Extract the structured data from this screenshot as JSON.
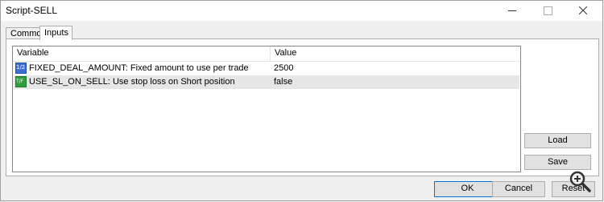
{
  "window": {
    "title": "Script-SELL"
  },
  "tabs": [
    {
      "label": "Common",
      "active": false
    },
    {
      "label": "Inputs",
      "active": true
    }
  ],
  "grid": {
    "columns": [
      "Variable",
      "Value"
    ],
    "rows": [
      {
        "icon": "numeric-input-icon",
        "name": "FIXED_DEAL_AMOUNT: Fixed amount to use per trade",
        "value": "2500",
        "selected": false
      },
      {
        "icon": "boolean-input-icon",
        "name": "USE_SL_ON_SELL: Use stop loss on Short position",
        "value": "false",
        "selected": true
      }
    ]
  },
  "buttons": {
    "load": "Load",
    "save": "Save",
    "ok": "OK",
    "cancel": "Cancel",
    "reset": "Reset"
  },
  "colors": {
    "accent": "#0078d7",
    "selected_row": "#e6e6e6"
  }
}
